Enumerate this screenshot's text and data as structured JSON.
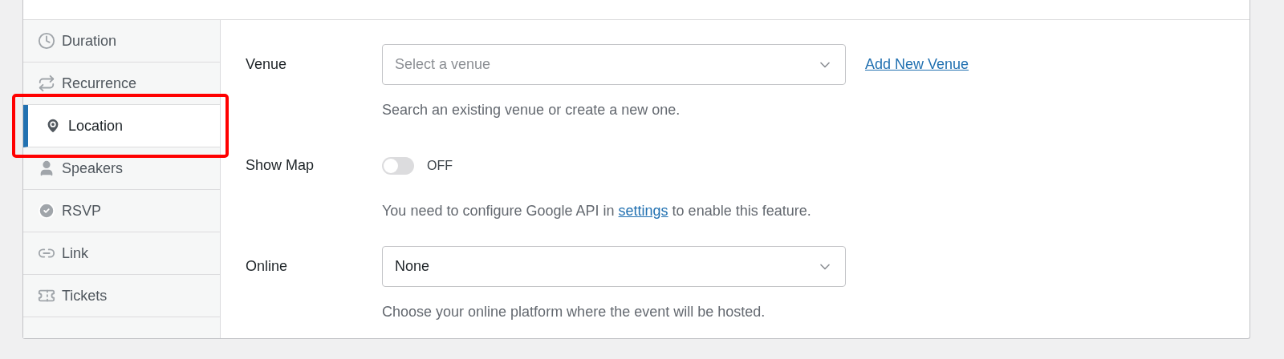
{
  "sidebar": {
    "items": [
      {
        "label": "Duration",
        "selected": false,
        "highlighted": false
      },
      {
        "label": "Recurrence",
        "selected": false,
        "highlighted": false
      },
      {
        "label": "Location",
        "selected": true,
        "highlighted": true
      },
      {
        "label": "Speakers",
        "selected": false,
        "highlighted": false
      },
      {
        "label": "RSVP",
        "selected": false,
        "highlighted": false
      },
      {
        "label": "Link",
        "selected": false,
        "highlighted": false
      },
      {
        "label": "Tickets",
        "selected": false,
        "highlighted": false
      }
    ]
  },
  "fields": [
    {
      "kind": "select",
      "label": "Venue",
      "placeholder": "Select a venue",
      "link": "Add New Venue",
      "help": "Search an existing venue or create a new one."
    },
    {
      "kind": "toggle",
      "label": "Show Map",
      "on": false,
      "state_text": "OFF",
      "help_before": "You need to configure Google API in ",
      "help_link": "settings",
      "help_after": " to enable this feature."
    },
    {
      "kind": "select",
      "label": "Online",
      "value": "None",
      "help": "Choose your online platform where the event will be hosted."
    }
  ]
}
